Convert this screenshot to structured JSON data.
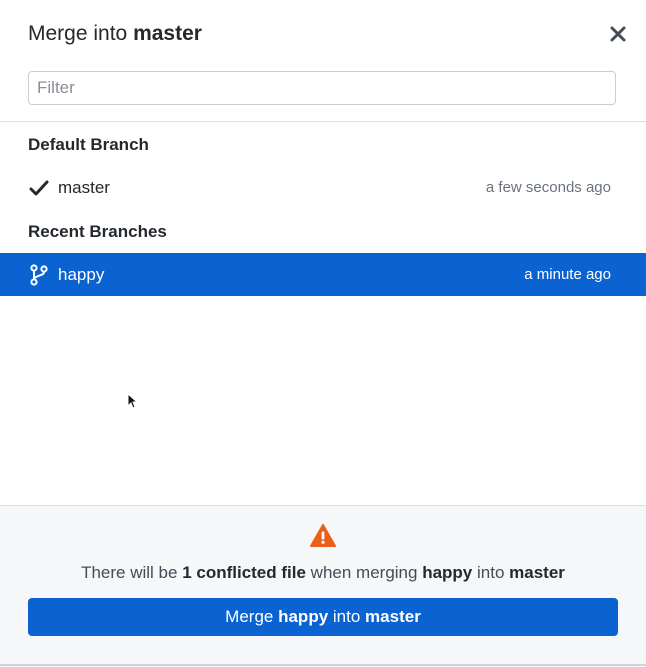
{
  "dialog": {
    "title_prefix": "Merge into",
    "title_branch": "master",
    "close_icon": "close-icon"
  },
  "filter": {
    "placeholder": "Filter",
    "value": ""
  },
  "default_section": {
    "label": "Default Branch",
    "branch": {
      "name": "master",
      "time": "a few seconds ago",
      "icon": "checkmark-icon"
    }
  },
  "recent_section": {
    "label": "Recent Branches",
    "branches": [
      {
        "name": "happy",
        "time": "a minute ago",
        "icon": "git-branch-icon",
        "selected": true
      }
    ]
  },
  "footer": {
    "warning_icon": "warning-icon",
    "message": {
      "prefix": "There will be",
      "count_text": "1 conflicted file",
      "middle": "when merging",
      "source": "happy",
      "joiner": "into",
      "target": "master"
    },
    "button": {
      "prefix": "Merge",
      "source": "happy",
      "joiner": "into",
      "target": "master"
    }
  },
  "colors": {
    "accent": "#0a63d1",
    "warning": "#e8601c",
    "footer_bg": "#f5f7f9"
  }
}
